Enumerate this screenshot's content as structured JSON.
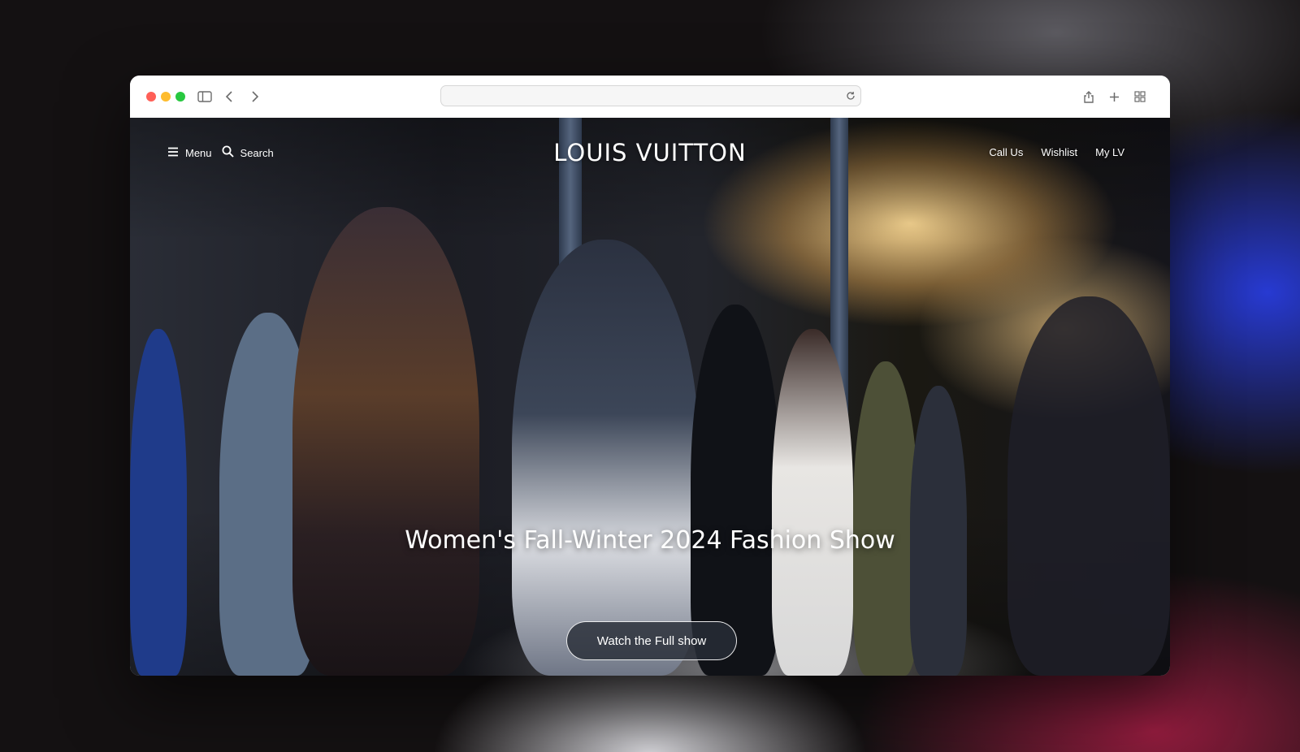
{
  "browser": {
    "traffic_lights": [
      "close",
      "minimize",
      "zoom"
    ],
    "url": "",
    "icons": [
      "sidebar-icon",
      "back-icon",
      "forward-icon",
      "reload-icon",
      "share-icon",
      "new-tab-icon",
      "tab-overview-icon"
    ]
  },
  "site": {
    "brand": "LOUIS VUITTON",
    "nav_left": {
      "menu_label": "Menu",
      "search_label": "Search"
    },
    "nav_right": [
      "Call Us",
      "Wishlist",
      "My LV"
    ]
  },
  "hero": {
    "title": "Women's Fall-Winter 2024 Fashion Show",
    "cta_label": "Watch the Full show",
    "image_description_icon": "runway-photo"
  },
  "colors": {
    "accent_red": "#ff5f57",
    "accent_yellow": "#febc2e",
    "accent_green": "#28c840",
    "cta_background": "#282d37"
  }
}
